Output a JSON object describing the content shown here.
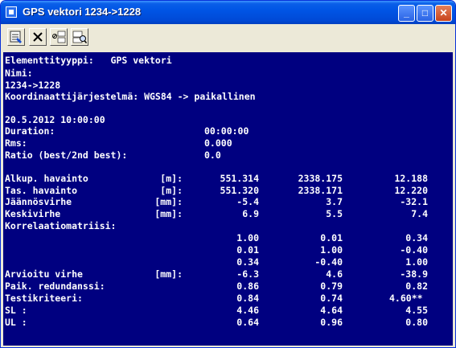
{
  "window": {
    "title": "GPS vektori 1234->1228",
    "minimize_label": "_",
    "maximize_label": "□",
    "close_label": "✕"
  },
  "toolbar": {
    "items": [
      {
        "name": "properties-icon"
      },
      {
        "name": "delete-icon"
      },
      {
        "name": "123-ab-icon"
      },
      {
        "name": "zoom-icon"
      }
    ]
  },
  "header": {
    "type_line": "Elementtityyppi:   GPS vektori",
    "name_label": "Nimi:",
    "name_value": "1234->1228",
    "coord_line": "Koordinaattijärjestelmä: WGS84 -> paikallinen"
  },
  "session": {
    "datetime": "20.5.2012 10:00:00",
    "duration_label": "Duration:",
    "duration_value": "00:00:00",
    "rms_label": "Rms:",
    "rms_value": "0.000",
    "ratio_label": "Ratio (best/2nd best):",
    "ratio_value": "0.0"
  },
  "table": {
    "rows": [
      {
        "label": "Alkup. havainto",
        "unit": "[m]:",
        "values": [
          "551.314",
          "2338.175",
          "12.188"
        ]
      },
      {
        "label": "Tas. havainto",
        "unit": "[m]:",
        "values": [
          "551.320",
          "2338.171",
          "12.220"
        ]
      },
      {
        "label": "Jäännösvirhe",
        "unit": "[mm]:",
        "values": [
          "-5.4",
          "3.7",
          "-32.1"
        ]
      },
      {
        "label": "Keskivirhe",
        "unit": "[mm]:",
        "values": [
          "6.9",
          "5.5",
          "7.4"
        ]
      }
    ],
    "correlation_label": "Korrelaatiomatriisi:",
    "correlation": [
      [
        "1.00",
        "0.01",
        "0.34"
      ],
      [
        "0.01",
        "1.00",
        "-0.40"
      ],
      [
        "0.34",
        "-0.40",
        "1.00"
      ]
    ],
    "rows2": [
      {
        "label": "Arvioitu virhe",
        "unit": "[mm]:",
        "values": [
          "-6.3",
          "4.6",
          "-38.9"
        ]
      },
      {
        "label": "Paik. redundanssi:",
        "unit": "",
        "values": [
          "0.86",
          "0.79",
          "0.82"
        ]
      },
      {
        "label": "Testikriteeri:",
        "unit": "",
        "values": [
          "0.84",
          "0.74",
          "4.60**"
        ]
      },
      {
        "label": "SL :",
        "unit": "",
        "values": [
          "4.46",
          "4.64",
          "4.55"
        ]
      },
      {
        "label": "UL :",
        "unit": "",
        "values": [
          "0.64",
          "0.96",
          "0.80"
        ]
      }
    ]
  },
  "colors": {
    "background": "#000080",
    "text": "#ffffff",
    "titlebar": "#0055e5"
  }
}
